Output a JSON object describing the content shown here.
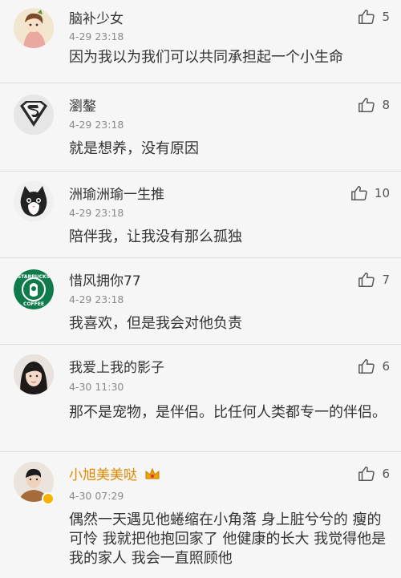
{
  "comments": [
    {
      "user": "脑补少女",
      "time": "4-29 23:18",
      "likes": "5",
      "text": "因为我以为我们可以共同承担起一个小生命",
      "avatar": "cartoon-girl-avatar"
    },
    {
      "user": "瀏鏊",
      "time": "4-29 23:18",
      "likes": "8",
      "text": "就是想养，没有原因",
      "avatar": "superman-logo-avatar"
    },
    {
      "user": "洲瑜洲瑜一生推",
      "time": "4-29 23:18",
      "likes": "10",
      "text": "陪伴我，让我没有那么孤独",
      "avatar": "cat-avatar"
    },
    {
      "user": "惜风拥你77",
      "time": "4-29 23:18",
      "likes": "7",
      "text": "我喜欢，但是我会对他负责",
      "avatar": "starbucks-logo-avatar"
    },
    {
      "user": "我爱上我的影子",
      "time": "4-30 11:30",
      "likes": "6",
      "text": "那不是宠物，是伴侣。比任何人类都专一的伴侣。",
      "avatar": "girl-photo-avatar"
    },
    {
      "user": "小旭美美哒",
      "time": "4-30 07:29",
      "likes": "6",
      "text": "偶然一天遇见他蜷缩在小角落 身上脏兮兮的 瘦的可怜 我就把他抱回家了 他健康的长大 我觉得他是我的家人 我会一直照顾他",
      "avatar": "boy-photo-avatar"
    }
  ],
  "starbucks": {
    "top": "STARBUCKS",
    "bottom": "COFFEE"
  },
  "colors": {
    "vip_name": "#e08a00",
    "like_icon": "#555555"
  }
}
